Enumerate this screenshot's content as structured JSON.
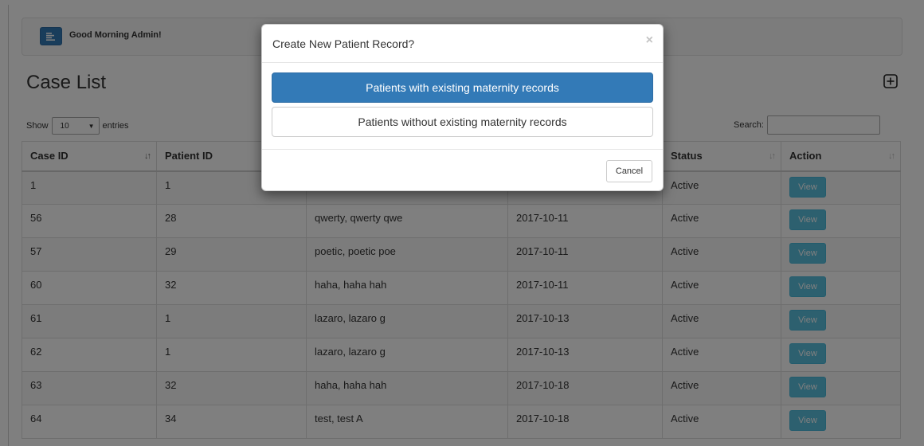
{
  "header": {
    "greeting": "Good Morning Admin!",
    "menu_icon": "hamburger-icon"
  },
  "page": {
    "title": "Case List",
    "add_icon": "plus-square-icon"
  },
  "table_controls": {
    "show_label": "Show",
    "entries_value": "10",
    "entries_label": "entries",
    "search_label": "Search:",
    "search_value": ""
  },
  "table": {
    "columns": [
      "Case ID",
      "Patient ID",
      "",
      "",
      "Status",
      "Action"
    ],
    "rows": [
      {
        "case_id": "1",
        "patient_id": "1",
        "name": "",
        "date": "",
        "status": "Active",
        "action": "View"
      },
      {
        "case_id": "56",
        "patient_id": "28",
        "name": "qwerty, qwerty qwe",
        "date": "2017-10-11",
        "status": "Active",
        "action": "View"
      },
      {
        "case_id": "57",
        "patient_id": "29",
        "name": "poetic, poetic poe",
        "date": "2017-10-11",
        "status": "Active",
        "action": "View"
      },
      {
        "case_id": "60",
        "patient_id": "32",
        "name": "haha, haha hah",
        "date": "2017-10-11",
        "status": "Active",
        "action": "View"
      },
      {
        "case_id": "61",
        "patient_id": "1",
        "name": "lazaro, lazaro g",
        "date": "2017-10-13",
        "status": "Active",
        "action": "View"
      },
      {
        "case_id": "62",
        "patient_id": "1",
        "name": "lazaro, lazaro g",
        "date": "2017-10-13",
        "status": "Active",
        "action": "View"
      },
      {
        "case_id": "63",
        "patient_id": "32",
        "name": "haha, haha hah",
        "date": "2017-10-18",
        "status": "Active",
        "action": "View"
      },
      {
        "case_id": "64",
        "patient_id": "34",
        "name": "test, test A",
        "date": "2017-10-18",
        "status": "Active",
        "action": "View"
      }
    ]
  },
  "modal": {
    "title": "Create New Patient Record?",
    "close_glyph": "×",
    "option_existing": "Patients with existing maternity records",
    "option_new": "Patients without existing maternity records",
    "cancel_label": "Cancel"
  },
  "colors": {
    "primary": "#337ab7",
    "info": "#5bc0de",
    "overlay": "rgba(0,0,0,0.5)"
  }
}
